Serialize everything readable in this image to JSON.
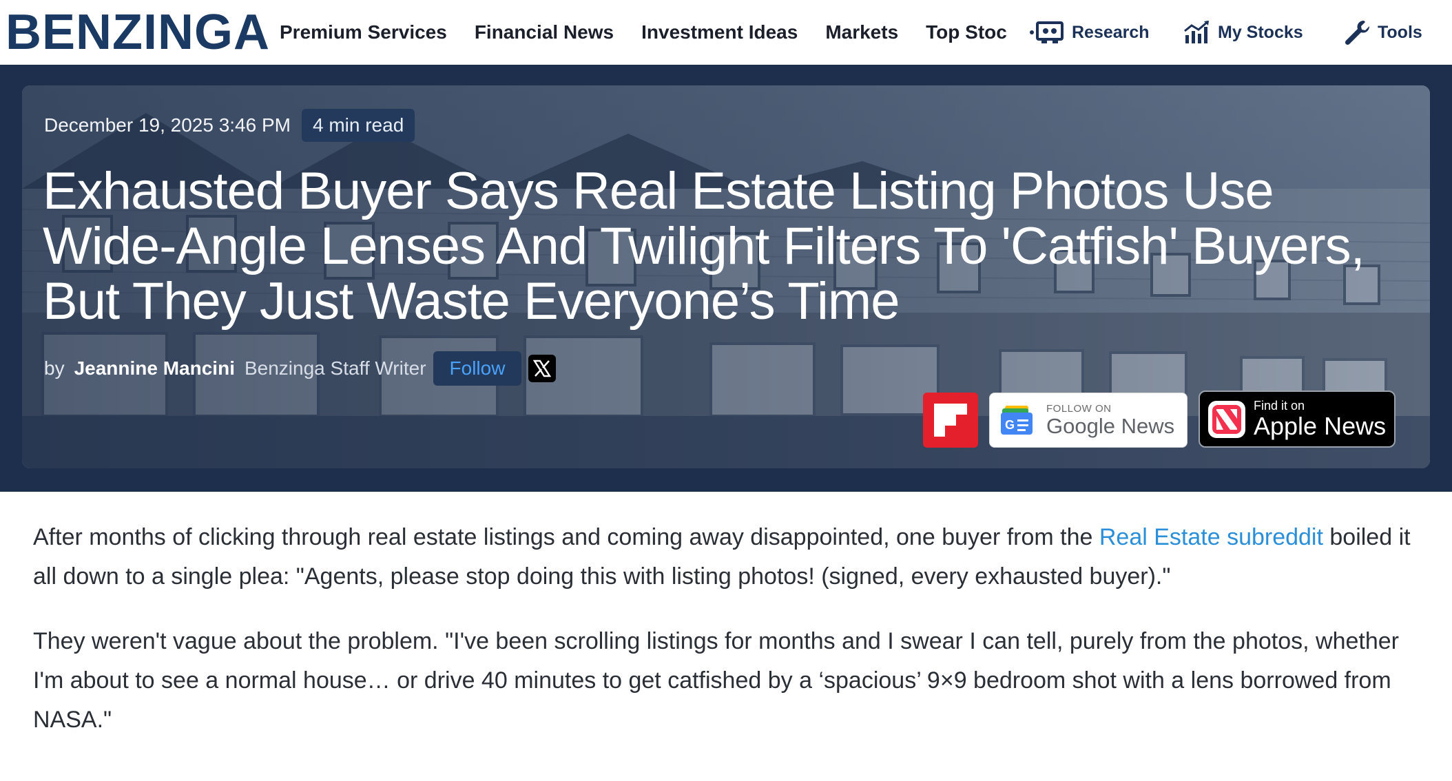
{
  "brand": {
    "logo": "BENZINGA",
    "navy": "#1a3a63",
    "hero_band": "#1d2f4c",
    "link_color": "#2a8fd8"
  },
  "nav": {
    "links": [
      "Premium Services",
      "Financial News",
      "Investment Ideas",
      "Markets",
      "Top Stoc"
    ],
    "research": {
      "label": "Research",
      "icon": "research-icon"
    },
    "my_stocks": {
      "label": "My Stocks",
      "icon": "chart-icon"
    },
    "tools": {
      "label": "Tools",
      "icon": "wrench-icon"
    }
  },
  "article": {
    "date": "December 19, 2025 3:46 PM",
    "read_time": "4 min read",
    "headline": "Exhausted Buyer Says Real Estate Listing Photos Use Wide-Angle Lenses And Twilight Filters To 'Catfish' Buyers, But They Just Waste Everyone’s Time",
    "byline": {
      "by": "by",
      "author": "Jeannine Mancini",
      "role": "Benzinga Staff Writer",
      "follow_label": "Follow",
      "x_icon": "x-icon"
    },
    "badges": {
      "flipboard_icon": "flipboard-icon",
      "google_news_small": "FOLLOW ON",
      "google_news_big": "Google News",
      "apple_small": "Find it on",
      "apple_big": "Apple News"
    },
    "paragraphs": [
      {
        "before_link": "After months of clicking through real estate listings and coming away disappointed, one buyer from the ",
        "link": "Real Estate subreddit",
        "after_link": " boiled it all down to a single plea: \"Agents, please stop doing this with listing photos! (signed, every exhausted buyer).\""
      },
      {
        "text": "They weren't vague about the problem. \"I've been scrolling listings for months and I swear I can tell, purely from the photos, whether I'm about to see a normal house… or drive 40 minutes to get catfished by a ‘spacious’ 9×9 bedroom shot with a lens borrowed from NASA.\""
      }
    ]
  }
}
